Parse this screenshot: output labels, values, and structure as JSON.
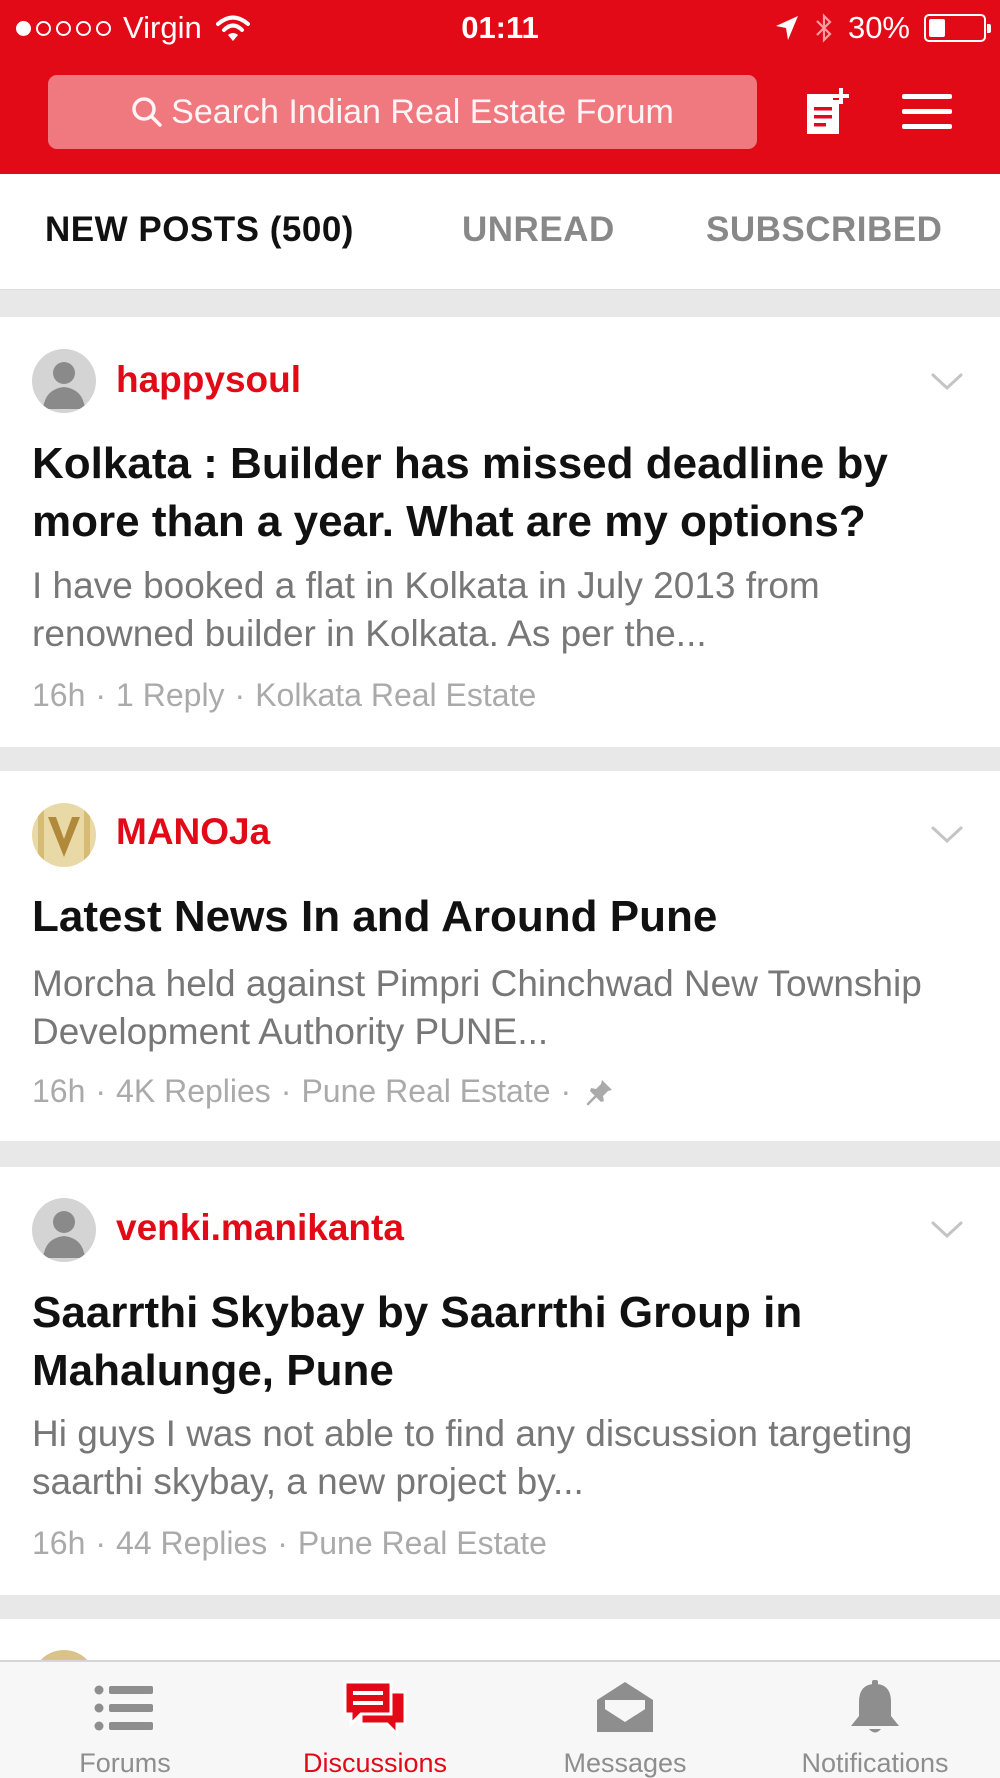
{
  "status_bar": {
    "carrier": "Virgin",
    "time": "01:11",
    "battery": "30%",
    "battery_level": 0.3,
    "signal_bars_filled": 1,
    "signal_bars_total": 5
  },
  "header": {
    "search_placeholder": "Search Indian Real Estate Forum",
    "accent_color": "#e30a17"
  },
  "tabs": [
    {
      "label": "NEW POSTS (500)",
      "active": true
    },
    {
      "label": "UNREAD",
      "active": false
    },
    {
      "label": "SUBSCRIBED",
      "active": false
    }
  ],
  "posts": [
    {
      "username": "happysoul",
      "avatar": "default-user-avatar",
      "title": "Kolkata : Builder has missed deadline by more than a year. What are my options?",
      "excerpt": "I have booked a flat in Kolkata in July 2013 from renowned builder in Kolkata. As per the...",
      "time": "16h",
      "replies": "1 Reply",
      "forum": "Kolkata Real Estate",
      "pinned": false
    },
    {
      "username": "MANOJa",
      "avatar": "custom-logo-avatar",
      "title": "Latest News  In and Around Pune",
      "excerpt": "Morcha held against Pimpri Chinchwad New Township Development Authority   PUNE...",
      "time": "16h",
      "replies": "4K Replies",
      "forum": "Pune Real Estate",
      "pinned": true
    },
    {
      "username": "venki.manikanta",
      "avatar": "default-user-avatar",
      "title": "Saarrthi Skybay by Saarrthi Group in Mahalunge, Pune",
      "excerpt": "Hi guys  I was not able to find any discussion targeting saarthi skybay, a new project by...",
      "time": "16h",
      "replies": "44 Replies",
      "forum": "Pune Real Estate",
      "pinned": false
    }
  ],
  "separator": "·",
  "tabbar": [
    {
      "label": "Forums",
      "icon": "list-icon",
      "active": false
    },
    {
      "label": "Discussions",
      "icon": "discussions-icon",
      "active": true
    },
    {
      "label": "Messages",
      "icon": "envelope-icon",
      "active": false
    },
    {
      "label": "Notifications",
      "icon": "bell-icon",
      "active": false
    }
  ]
}
